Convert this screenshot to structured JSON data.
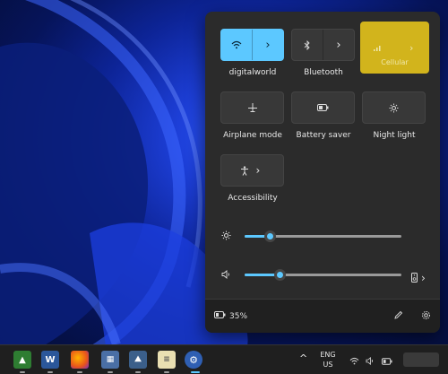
{
  "tiles": {
    "wifi": {
      "label": "digitalworld",
      "icon": "wifi-icon",
      "chevron": "›"
    },
    "bluetooth": {
      "label": "Bluetooth",
      "icon": "bluetooth-icon",
      "chevron": "›"
    },
    "cellular": {
      "label": "Cellular",
      "icon": "cellular-icon",
      "chevron": "›"
    },
    "airplane": {
      "label": "Airplane mode",
      "icon": "airplane-icon"
    },
    "battery_saver": {
      "label": "Battery saver",
      "icon": "battery-saver-icon"
    },
    "night_light": {
      "label": "Night light",
      "icon": "night-light-icon"
    },
    "accessibility": {
      "label": "Accessibility",
      "icon": "accessibility-icon",
      "chevron": "›"
    }
  },
  "sliders": {
    "brightness": {
      "icon": "brightness-icon",
      "level": 0.16
    },
    "volume": {
      "icon": "speaker-icon",
      "level": 0.22,
      "output_chevron": "›"
    }
  },
  "footer": {
    "battery_percent": "35%"
  },
  "taskbar": {
    "language_top": "ENG",
    "language_bottom": "US"
  },
  "colors": {
    "accent": "#5cc8ff",
    "highlight": "#d2b41c",
    "panel": "#2b2b2b"
  }
}
